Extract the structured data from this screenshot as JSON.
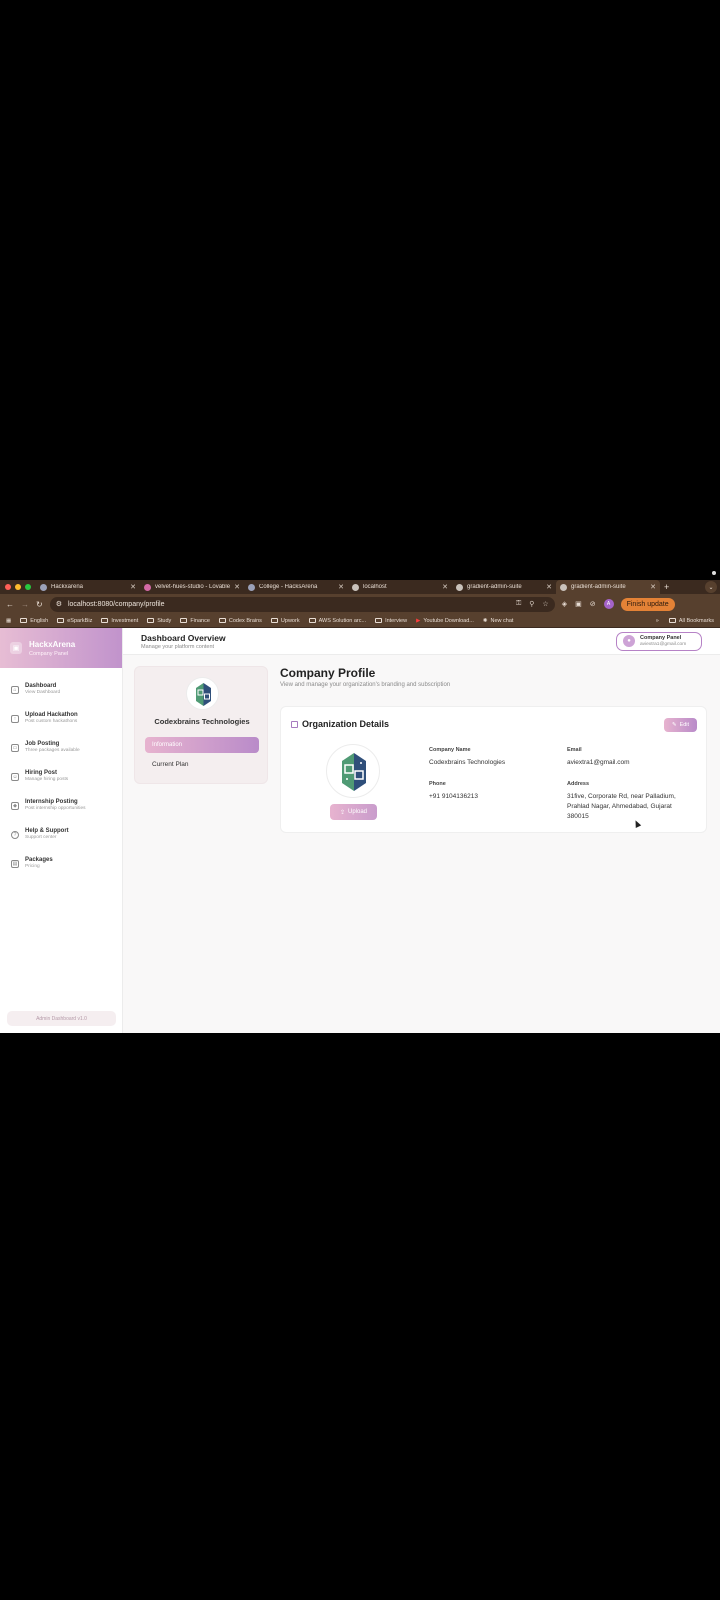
{
  "browser": {
    "tabs": [
      {
        "label": "Hackxarena",
        "active": false
      },
      {
        "label": "velvet-hues-studio - Lovable",
        "active": false
      },
      {
        "label": "College - HacksArena",
        "active": false
      },
      {
        "label": "localhost",
        "active": false
      },
      {
        "label": "gradient-admin-suite",
        "active": false
      },
      {
        "label": "gradient-admin-suite",
        "active": true
      }
    ],
    "new_tab": "+",
    "url": "localhost:8080/company/profile",
    "profile_initial": "A",
    "finish_update": "Finish update",
    "bookmarks": [
      "English",
      "eSparkBiz",
      "Investment",
      "Study",
      "Finance",
      "Codex Brains",
      "Upwork",
      "AWS Solution arc...",
      "Interview",
      "Youtube Download...",
      "New chat"
    ],
    "bookmarks_more": "»",
    "all_bookmarks": "All Bookmarks"
  },
  "sidebar": {
    "brand_name": "HackxArena",
    "brand_sub": "Company Panel",
    "items": [
      {
        "label": "Dashboard",
        "sub": "View Dashboard",
        "icon": "home-icon"
      },
      {
        "label": "Upload Hackathon",
        "sub": "Post custom hackathons",
        "icon": "upload-icon"
      },
      {
        "label": "Job Posting",
        "sub": "Three packages available",
        "icon": "briefcase-icon"
      },
      {
        "label": "Hiring Post",
        "sub": "Manage hiring posts",
        "icon": "users-icon"
      },
      {
        "label": "Internship Posting",
        "sub": "Post internship opportunities",
        "icon": "graduation-cap-icon"
      },
      {
        "label": "Help & Support",
        "sub": "Support center",
        "icon": "help-icon"
      },
      {
        "label": "Packages",
        "sub": "Pricing",
        "icon": "package-icon"
      }
    ],
    "version": "Admin Dashboard v1.0"
  },
  "header": {
    "title": "Dashboard Overview",
    "subtitle": "Manage your platform content",
    "panel_name": "Company Panel",
    "panel_email": "aviextra1@gmail.com"
  },
  "profile_nav": {
    "company_name": "Codexbrains Technologies",
    "tabs": [
      "Information",
      "Current Plan"
    ]
  },
  "page": {
    "title": "Company Profile",
    "subtitle": "View and manage your organization's branding and subscription"
  },
  "org": {
    "title": "Organization Details",
    "edit_label": "Edit",
    "upload_label": "Upload",
    "company_name_label": "Company Name",
    "company_name": "Codexbrains Technologies",
    "email_label": "Email",
    "email": "aviextra1@gmail.com",
    "phone_label": "Phone",
    "phone": "+91 9104136213",
    "address_label": "Address",
    "address_lines": [
      "31five, Corporate Rd, near Palladium,",
      "Prahlad Nagar, Ahmedabad, Gujarat",
      "380015"
    ]
  }
}
